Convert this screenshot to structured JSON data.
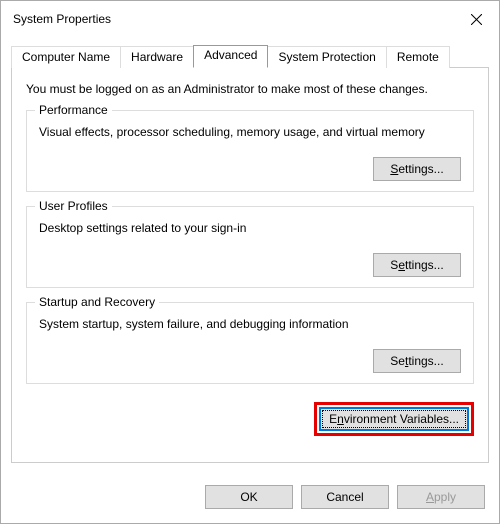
{
  "window": {
    "title": "System Properties"
  },
  "tabs": {
    "computer_name": "Computer Name",
    "hardware": "Hardware",
    "advanced": "Advanced",
    "system_protection": "System Protection",
    "remote": "Remote"
  },
  "intro": "You must be logged on as an Administrator to make most of these changes.",
  "groups": {
    "performance": {
      "legend": "Performance",
      "desc": "Visual effects, processor scheduling, memory usage, and virtual memory",
      "button": "Settings..."
    },
    "user_profiles": {
      "legend": "User Profiles",
      "desc": "Desktop settings related to your sign-in",
      "button": "Settings..."
    },
    "startup": {
      "legend": "Startup and Recovery",
      "desc": "System startup, system failure, and debugging information",
      "button": "Settings..."
    }
  },
  "env_button": "Environment Variables...",
  "dialog_buttons": {
    "ok": "OK",
    "cancel": "Cancel",
    "apply": "Apply"
  }
}
